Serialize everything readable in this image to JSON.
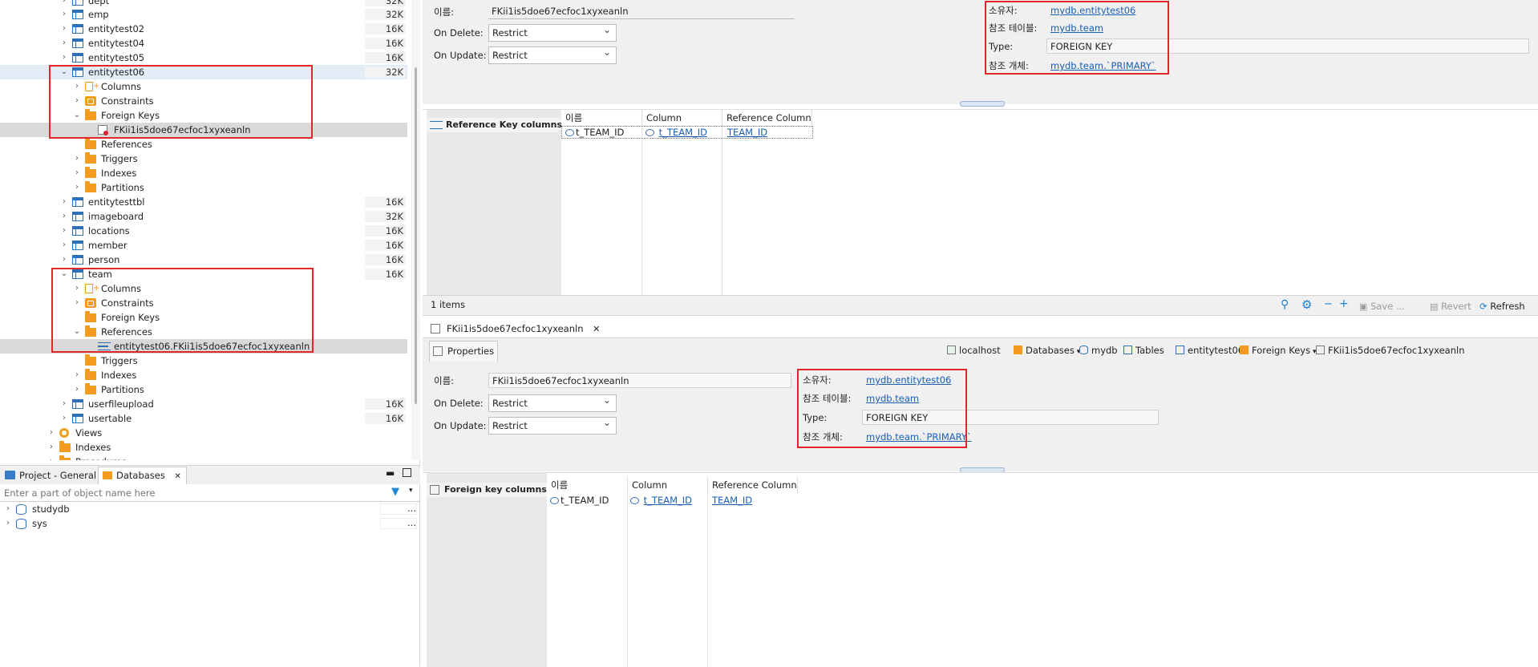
{
  "tree": {
    "rows": [
      {
        "label": "dept",
        "size": "32K"
      },
      {
        "label": "emp",
        "size": "32K"
      },
      {
        "label": "entitytest02",
        "size": "16K"
      },
      {
        "label": "entitytest04",
        "size": "16K"
      },
      {
        "label": "entitytest05",
        "size": "16K"
      },
      {
        "label": "entitytest06",
        "size": "32K"
      },
      {
        "label": "Columns"
      },
      {
        "label": "Constraints"
      },
      {
        "label": "Foreign Keys"
      },
      {
        "label": "FKii1is5doe67ecfoc1xyxeanln"
      },
      {
        "label": "References"
      },
      {
        "label": "Triggers"
      },
      {
        "label": "Indexes"
      },
      {
        "label": "Partitions"
      },
      {
        "label": "entitytesttbl",
        "size": "16K"
      },
      {
        "label": "imageboard",
        "size": "32K"
      },
      {
        "label": "locations",
        "size": "16K"
      },
      {
        "label": "member",
        "size": "16K"
      },
      {
        "label": "person",
        "size": "16K"
      },
      {
        "label": "team",
        "size": "16K"
      },
      {
        "label": "Columns"
      },
      {
        "label": "Constraints"
      },
      {
        "label": "Foreign Keys"
      },
      {
        "label": "References"
      },
      {
        "label": "entitytest06.FKii1is5doe67ecfoc1xyxeanln"
      },
      {
        "label": "Triggers"
      },
      {
        "label": "Indexes"
      },
      {
        "label": "Partitions"
      },
      {
        "label": "userfileupload",
        "size": "16K"
      },
      {
        "label": "usertable",
        "size": "16K"
      },
      {
        "label": "Views"
      },
      {
        "label": "Indexes"
      },
      {
        "label": "Procedures"
      }
    ]
  },
  "bottom_left": {
    "tab_project": "Project - General",
    "tab_databases": "Databases",
    "filter_placeholder": "Enter a part of object name here",
    "dbs": [
      "studydb",
      "sys"
    ],
    "ellipsis": "..."
  },
  "top_props": {
    "name_label": "이름:",
    "name_value": "FKii1is5doe67ecfoc1xyxeanln",
    "on_delete_label": "On Delete:",
    "on_delete_value": "Restrict",
    "on_update_label": "On Update:",
    "on_update_value": "Restrict",
    "owner_label": "소유자:",
    "owner_value": "mydb.entitytest06",
    "ref_table_label": "참조 테이블:",
    "ref_table_value": "mydb.team",
    "type_label": "Type:",
    "type_value": "FOREIGN KEY",
    "ref_obj_label": "참조 개체:",
    "ref_obj_value": "mydb.team.`PRIMARY`"
  },
  "ref_key_section": {
    "title": "Reference Key columns",
    "headers": [
      "이름",
      "Column",
      "Reference Column"
    ],
    "row": [
      "t_TEAM_ID",
      "t_TEAM_ID",
      "TEAM_ID"
    ],
    "items": "1 items",
    "save": "Save ...",
    "revert": "Revert",
    "refresh": "Refresh"
  },
  "editor_tab": {
    "label": "FKii1is5doe67ecfoc1xyxeanln",
    "close": "✕"
  },
  "properties_tab": "Properties",
  "breadcrumb": [
    "localhost",
    "Databases",
    "mydb",
    "Tables",
    "entitytest06",
    "Foreign Keys",
    "FKii1is5doe67ecfoc1xyxeanln"
  ],
  "bottom_props": {
    "name_label": "이름:",
    "name_value": "FKii1is5doe67ecfoc1xyxeanln",
    "on_delete_label": "On Delete:",
    "on_delete_value": "Restrict",
    "on_update_label": "On Update:",
    "on_update_value": "Restrict",
    "owner_label": "소유자:",
    "owner_value": "mydb.entitytest06",
    "ref_table_label": "참조 테이블:",
    "ref_table_value": "mydb.team",
    "type_label": "Type:",
    "type_value": "FOREIGN KEY",
    "ref_obj_label": "참조 개체:",
    "ref_obj_value": "mydb.team.`PRIMARY`"
  },
  "fk_section": {
    "title": "Foreign key columns",
    "headers": [
      "이름",
      "Column",
      "Reference Column"
    ],
    "row": [
      "t_TEAM_ID",
      "t_TEAM_ID",
      "TEAM_ID"
    ]
  },
  "colors": {
    "highlight_box": "#e0272c",
    "link": "#1a5fb4",
    "folder": "#f29b1d",
    "table": "#2f6fb3"
  }
}
